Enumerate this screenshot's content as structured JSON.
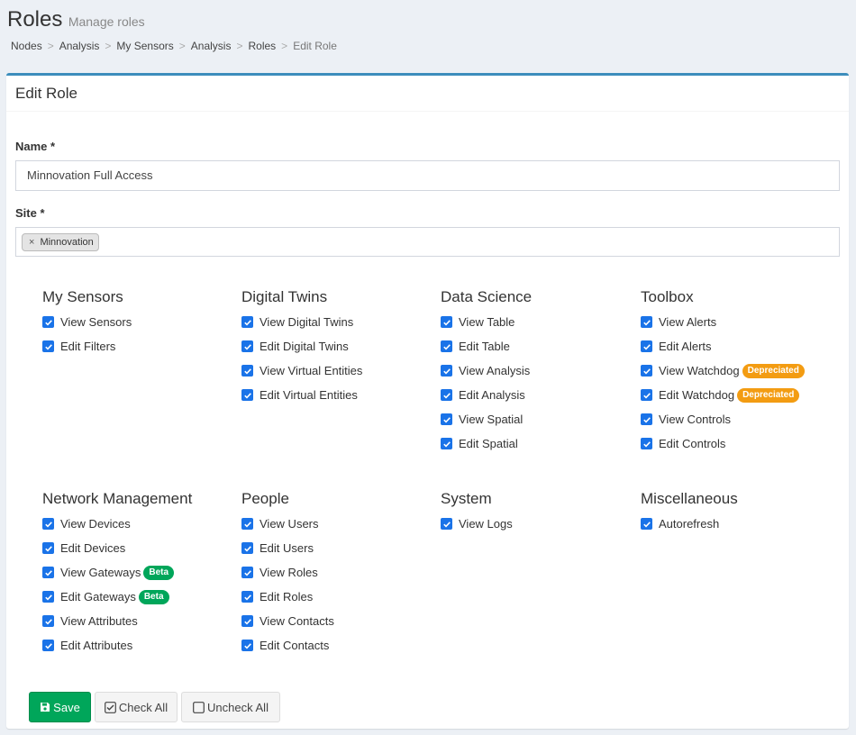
{
  "header": {
    "title": "Roles",
    "subtitle": "Manage roles"
  },
  "breadcrumb": [
    "Nodes",
    "Analysis",
    "My Sensors",
    "Analysis",
    "Roles",
    "Edit Role"
  ],
  "box": {
    "title": "Edit Role"
  },
  "form": {
    "name_label": "Name *",
    "name_value": "Minnovation Full Access",
    "site_label": "Site *",
    "site_remove": "×",
    "site_tag": "Minnovation"
  },
  "groups": [
    {
      "title": "My Sensors",
      "items": [
        {
          "label": "View Sensors",
          "checked": true
        },
        {
          "label": "Edit Filters",
          "checked": true
        }
      ]
    },
    {
      "title": "Digital Twins",
      "items": [
        {
          "label": "View Digital Twins",
          "checked": true
        },
        {
          "label": "Edit Digital Twins",
          "checked": true
        },
        {
          "label": "View Virtual Entities",
          "checked": true
        },
        {
          "label": "Edit Virtual Entities",
          "checked": true
        }
      ]
    },
    {
      "title": "Data Science",
      "items": [
        {
          "label": "View Table",
          "checked": true
        },
        {
          "label": "Edit Table",
          "checked": true
        },
        {
          "label": "View Analysis",
          "checked": true
        },
        {
          "label": "Edit Analysis",
          "checked": true
        },
        {
          "label": "View Spatial",
          "checked": true
        },
        {
          "label": "Edit Spatial",
          "checked": true
        }
      ]
    },
    {
      "title": "Toolbox",
      "items": [
        {
          "label": "View Alerts",
          "checked": true
        },
        {
          "label": "Edit Alerts",
          "checked": true
        },
        {
          "label": "View Watchdog",
          "checked": true,
          "badge": "Depreciated"
        },
        {
          "label": "Edit Watchdog",
          "checked": true,
          "badge": "Depreciated"
        },
        {
          "label": "View Controls",
          "checked": true
        },
        {
          "label": "Edit Controls",
          "checked": true
        }
      ]
    },
    {
      "title": "Network Management",
      "items": [
        {
          "label": "View Devices",
          "checked": true
        },
        {
          "label": "Edit Devices",
          "checked": true
        },
        {
          "label": "View Gateways",
          "checked": true,
          "badge": "Beta"
        },
        {
          "label": "Edit Gateways",
          "checked": true,
          "badge": "Beta"
        },
        {
          "label": "View Attributes",
          "checked": true
        },
        {
          "label": "Edit Attributes",
          "checked": true
        }
      ]
    },
    {
      "title": "People",
      "items": [
        {
          "label": "View Users",
          "checked": true
        },
        {
          "label": "Edit Users",
          "checked": true
        },
        {
          "label": "View Roles",
          "checked": true
        },
        {
          "label": "Edit Roles",
          "checked": true
        },
        {
          "label": "View Contacts",
          "checked": true
        },
        {
          "label": "Edit Contacts",
          "checked": true
        }
      ]
    },
    {
      "title": "System",
      "items": [
        {
          "label": "View Logs",
          "checked": true
        }
      ]
    },
    {
      "title": "Miscellaneous",
      "items": [
        {
          "label": "Autorefresh",
          "checked": true
        }
      ]
    }
  ],
  "buttons": {
    "save": "Save",
    "check_all": "Check All",
    "uncheck_all": "Uncheck All"
  },
  "colors": {
    "accent": "#3c8dbc",
    "checkbox": "#1a73e8",
    "success": "#00a65a",
    "warning": "#f39c12"
  }
}
